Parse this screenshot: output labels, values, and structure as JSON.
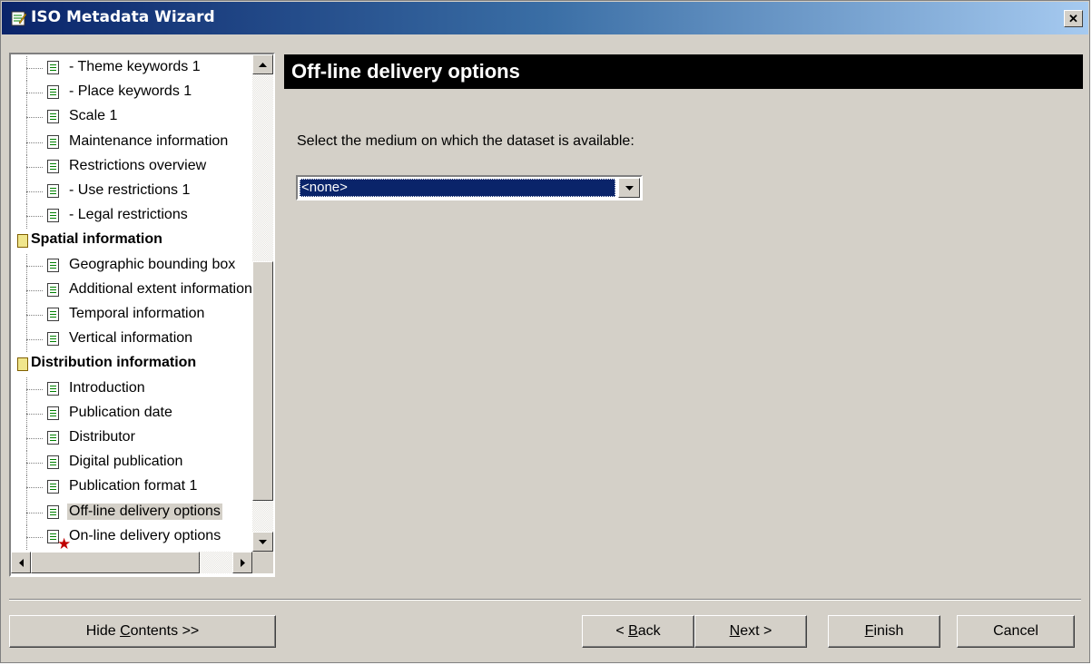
{
  "window": {
    "title": "ISO Metadata Wizard",
    "close_glyph": "✕"
  },
  "tree": {
    "items": [
      {
        "label": "- Theme keywords 1",
        "kind": "item"
      },
      {
        "label": "- Place keywords 1",
        "kind": "item"
      },
      {
        "label": "Scale 1",
        "kind": "item"
      },
      {
        "label": "Maintenance information",
        "kind": "item"
      },
      {
        "label": "Restrictions overview",
        "kind": "item"
      },
      {
        "label": "- Use restrictions 1",
        "kind": "item"
      },
      {
        "label": "- Legal restrictions",
        "kind": "item"
      },
      {
        "label": "Spatial information",
        "kind": "group"
      },
      {
        "label": "Geographic bounding box",
        "kind": "item"
      },
      {
        "label": "Additional extent information",
        "kind": "item"
      },
      {
        "label": "Temporal information",
        "kind": "item"
      },
      {
        "label": "Vertical information",
        "kind": "item"
      },
      {
        "label": "Distribution information",
        "kind": "group"
      },
      {
        "label": "Introduction",
        "kind": "item"
      },
      {
        "label": "Publication date",
        "kind": "item"
      },
      {
        "label": "Distributor",
        "kind": "item"
      },
      {
        "label": "Digital publication",
        "kind": "item"
      },
      {
        "label": "Publication format 1",
        "kind": "item"
      },
      {
        "label": "Off-line delivery options",
        "kind": "item",
        "selected": true
      },
      {
        "label": "On-line delivery options",
        "kind": "item",
        "required": true
      }
    ]
  },
  "content": {
    "title": "Off-line delivery options",
    "prompt": "Select the medium on which the dataset is available:",
    "medium_value": "<none>"
  },
  "buttons": {
    "hide_contents_pre": "Hide ",
    "hide_contents_u": "C",
    "hide_contents_post": "ontents >>",
    "back_pre": "< ",
    "back_u": "B",
    "back_post": "ack",
    "next_u": "N",
    "next_post": "ext >",
    "finish_u": "F",
    "finish_post": "inish",
    "cancel": "Cancel"
  },
  "colors": {
    "title_bar": "#0a246a",
    "window_face": "#d4d0c8",
    "selection": "#0a246a",
    "required_star": "#c00000"
  }
}
